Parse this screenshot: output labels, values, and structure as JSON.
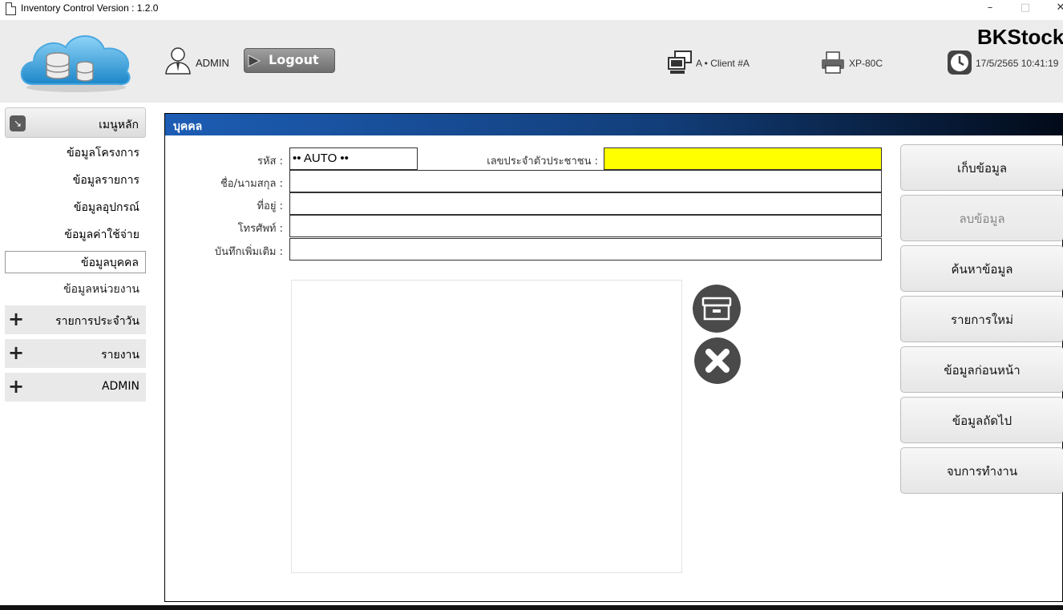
{
  "window": {
    "title": "Inventory Control Version : 1.2.0",
    "minimize": "–",
    "maximize": "□",
    "close": "✕"
  },
  "header": {
    "brand": "BKStock",
    "user": "ADMIN",
    "logout_label": "Logout",
    "client": "A • Client #A",
    "printer": "XP-80C",
    "datetime": "17/5/2565 10:41:19"
  },
  "sidebar": {
    "main_menu": "เมนูหลัก",
    "items": [
      {
        "label": "ข้อมูลโครงการ"
      },
      {
        "label": "ข้อมูลรายการ"
      },
      {
        "label": "ข้อมูลอุปกรณ์"
      },
      {
        "label": "ข้อมูลค่าใช้จ่าย"
      },
      {
        "label": "ข้อมูลบุคคล"
      },
      {
        "label": "ข้อมูลหน่วยงาน"
      }
    ],
    "groups": [
      {
        "label": "รายการประจำวัน"
      },
      {
        "label": "รายงาน"
      },
      {
        "label": "ADMIN"
      }
    ]
  },
  "panel": {
    "title": "บุคคล",
    "labels": {
      "code": "รหัส :",
      "national_id": "เลขประจำตัวประชาชน :",
      "name": "ชื่อ/นามสกุล :",
      "address": "ที่อยู่ :",
      "phone": "โทรศัพท์ :",
      "note": "บันทึกเพิ่มเติม :"
    },
    "values": {
      "code": "•• AUTO ••",
      "national_id": "",
      "name": "",
      "address": "",
      "phone": "",
      "note": ""
    }
  },
  "actions": [
    {
      "label": "เก็บข้อมูล"
    },
    {
      "label": "ลบข้อมูล"
    },
    {
      "label": "ค้นหาข้อมูล"
    },
    {
      "label": "รายการใหม่"
    },
    {
      "label": "ข้อมูลก่อนหน้า"
    },
    {
      "label": "ข้อมูลถัดไป"
    },
    {
      "label": "จบการทำงาน"
    }
  ],
  "colors": {
    "header_bg": "#ececec",
    "panel_head_start": "#1d5db4",
    "panel_head_end": "#020a18",
    "highlight_field": "#ffff00"
  }
}
